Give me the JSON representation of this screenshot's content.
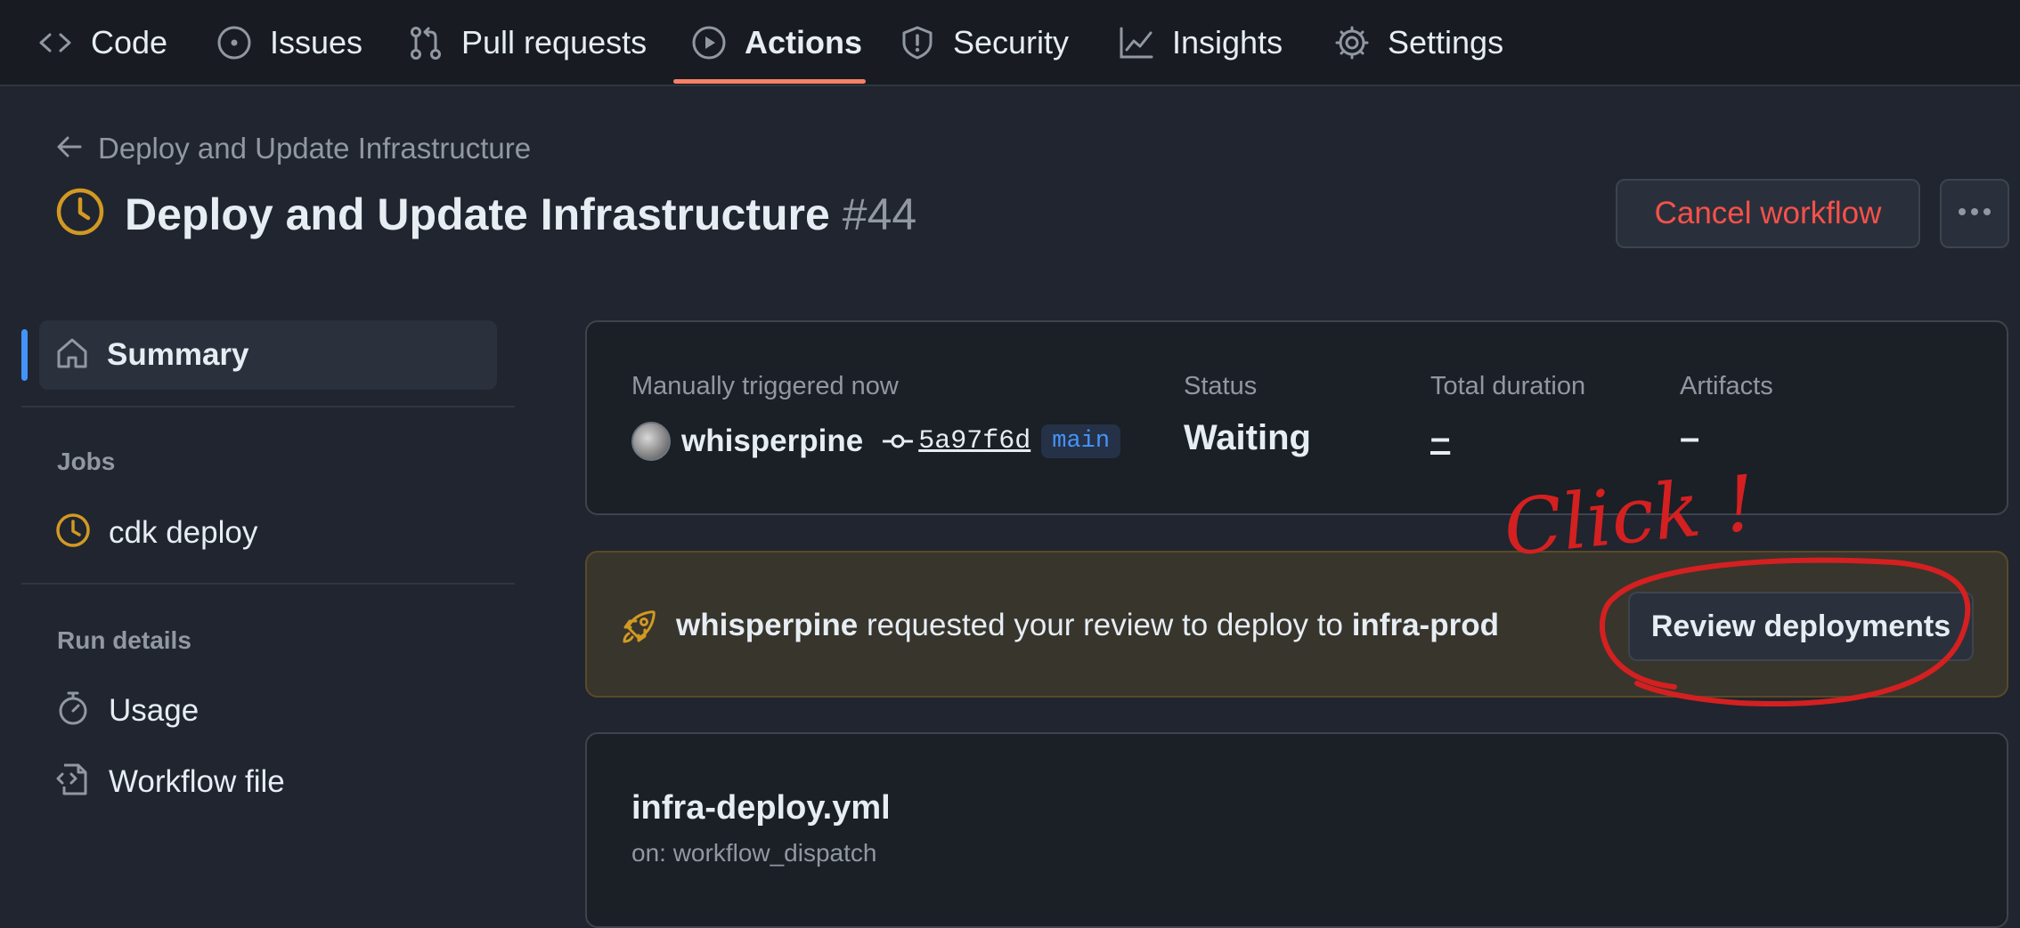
{
  "nav": {
    "tabs": [
      {
        "label": "Code",
        "icon": "code-icon"
      },
      {
        "label": "Issues",
        "icon": "issue-opened-icon"
      },
      {
        "label": "Pull requests",
        "icon": "git-pull-request-icon"
      },
      {
        "label": "Actions",
        "icon": "play-icon",
        "active": true
      },
      {
        "label": "Security",
        "icon": "shield-icon"
      },
      {
        "label": "Insights",
        "icon": "graph-icon"
      },
      {
        "label": "Settings",
        "icon": "gear-icon"
      }
    ]
  },
  "header": {
    "back_label": "Deploy and Update Infrastructure",
    "title": "Deploy and Update Infrastructure",
    "run_number": "#44",
    "status_icon": "clock-icon",
    "cancel_label": "Cancel workflow",
    "more_icon": "kebab-horizontal-icon"
  },
  "sidebar": {
    "summary_label": "Summary",
    "jobs_heading": "Jobs",
    "jobs": [
      {
        "label": "cdk deploy",
        "icon": "clock-icon"
      }
    ],
    "run_details_heading": "Run details",
    "run_details": [
      {
        "label": "Usage",
        "icon": "stopwatch-icon"
      },
      {
        "label": "Workflow file",
        "icon": "file-code-icon"
      }
    ]
  },
  "summary": {
    "trigger_label": "Manually triggered now",
    "actor": "whisperpine",
    "commit": "5a97f6d",
    "branch": "main",
    "status_label": "Status",
    "status_value": "Waiting",
    "duration_label": "Total duration",
    "duration_value": "–",
    "artifacts_label": "Artifacts",
    "artifacts_value": "–"
  },
  "review": {
    "requester": "whisperpine",
    "message": " requested your review to deploy to ",
    "environment": "infra-prod",
    "button_label": "Review deployments",
    "icon": "rocket-icon"
  },
  "workflow": {
    "file_name": "infra-deploy.yml",
    "trigger": "on: workflow_dispatch"
  },
  "annotation": {
    "text": "Click !",
    "color": "#d42020"
  },
  "colors": {
    "accent_underline": "#f78166",
    "danger": "#f85149",
    "waiting": "#d29922",
    "link": "#4493f8"
  }
}
